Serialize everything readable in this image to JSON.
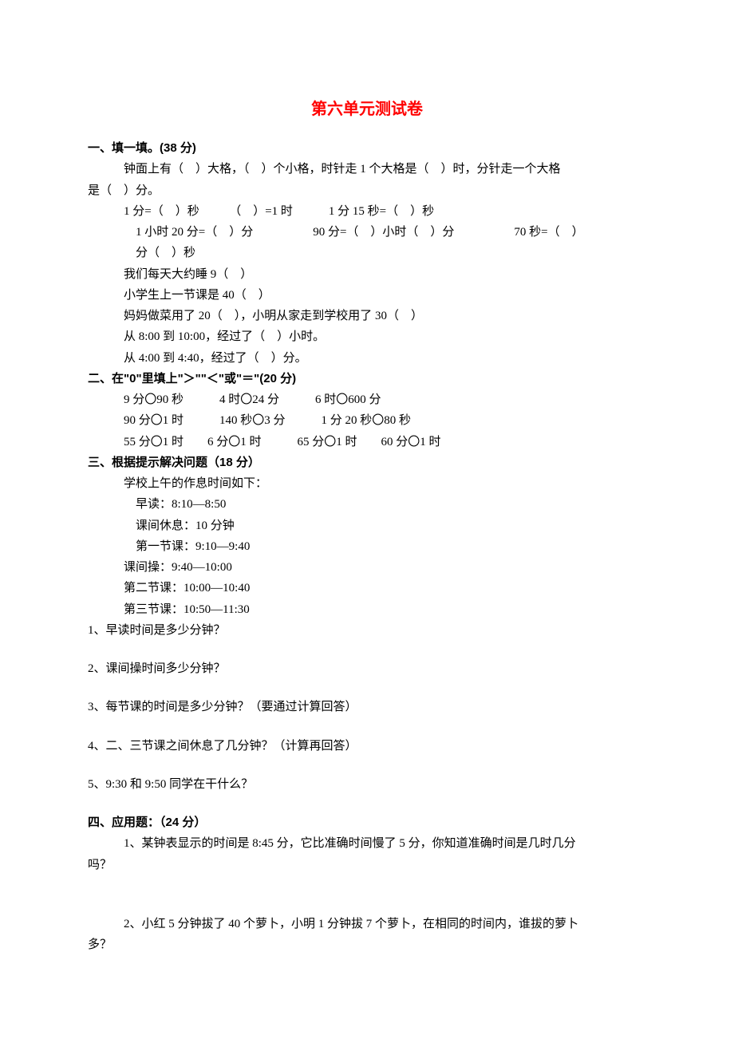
{
  "title": "第六单元测试卷",
  "s1": {
    "head": "一、填一填。(38 分)",
    "l1": "钟面上有（　）大格，（　）个小格，时针走 1 个大格是（　）时，分针走一个大格",
    "l2": "是（　）分。",
    "l3": "1 分=（　）秒　　　（　）=1 时　　　1 分 15 秒=（　）秒",
    "l4": "　1 小时 20 分=（　）分　　　　　90 分=（　）小时（　）分　　　　　70 秒=（　）",
    "l5": "　分（　）秒",
    "l6": "我们每天大约睡 9（　）",
    "l7": "小学生上一节课是 40（　）",
    "l8": "妈妈做菜用了 20（　），小明从家走到学校用了 30（　）",
    "l9": "从 8:00 到 10:00，经过了（　）小时。",
    "l10": "从 4:00 到 4:40，经过了（　）分。"
  },
  "s2": {
    "head": "二、在\"0\"里填上\"＞\"\"＜\"或\"＝\"(20 分)",
    "l1": "9 分〇90 秒　　　4 时〇24 分　　　6 时〇600 分",
    "l2": "90 分〇1 时　　　140 秒〇3 分　　　1 分 20 秒〇80 秒",
    "l3": "55 分〇1 时　　6 分〇1 时　　　65 分〇1 时　　60 分〇1 时"
  },
  "s3": {
    "head": "三、根据提示解决问题（18 分）",
    "l1": "学校上午的作息时间如下：",
    "l2": "　早读：8:10—8:50",
    "l3": "　课间休息：10 分钟",
    "l4": "　第一节课：9:10—9:40",
    "l5": "课间操：9:40—10:00",
    "l6": "第二节课：10:00—10:40",
    "l7": "第三节课：10:50—11:30",
    "q1": "1、早读时间是多少分钟？",
    "q2": "2、课间操时间多少分钟？",
    "q3": "3、每节课的时间是多少分钟？（要通过计算回答）",
    "q4": "4、二、三节课之间休息了几分钟？（计算再回答）",
    "q5": "5、9:30 和 9:50 同学在干什么？"
  },
  "s4": {
    "head": "四、应用题：（24 分）",
    "q1a": "1、某钟表显示的时间是 8:45 分，它比准确时间慢了 5 分，你知道准确时间是几时几分",
    "q1b": "吗？",
    "q2a": "2、小红 5 分钟拔了 40 个萝卜，小明 1 分钟拔 7 个萝卜，在相同的时间内，谁拔的萝卜",
    "q2b": "多？"
  }
}
